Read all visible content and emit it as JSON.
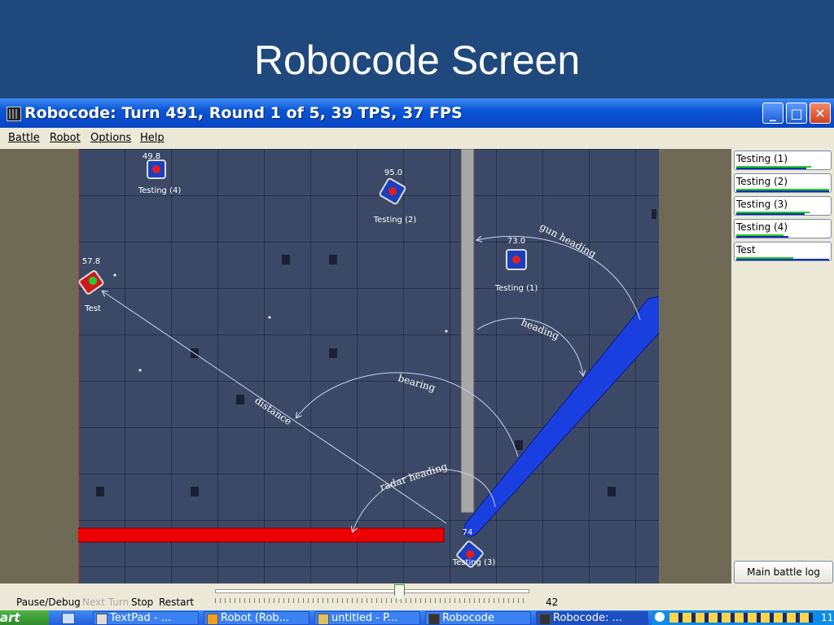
{
  "slide": {
    "title": "Robocode Screen"
  },
  "window": {
    "title": "Robocode: Turn 491, Round 1 of 5, 39 TPS, 37 FPS",
    "controls": {
      "minimize": "_",
      "maximize": "□",
      "close": "✕"
    }
  },
  "menu": [
    "Battle",
    "Robot",
    "Options",
    "Help"
  ],
  "arena": {
    "robots": [
      {
        "name": "Testing (4)",
        "energy": "49.8"
      },
      {
        "name": "Testing (2)",
        "energy": "95.0"
      },
      {
        "name": "Testing (1)",
        "energy": "73.0"
      },
      {
        "name": "Test",
        "energy": "57.8"
      },
      {
        "name": "Testing (3)",
        "energy": "74"
      }
    ],
    "annotations": {
      "gun_heading": "gun heading",
      "heading": "heading",
      "bearing": "bearing",
      "distance": "distance",
      "radar_heading": "radar heading"
    },
    "colors": {
      "radar_beam": "#1a3fe0",
      "test_bar": "#ee0000",
      "wall_bar": "#a8a8a8"
    }
  },
  "side_panel": {
    "robots": [
      {
        "label": "Testing (1)",
        "energy_color": "#22cc22"
      },
      {
        "label": "Testing (2)",
        "energy_color": "#22cc22"
      },
      {
        "label": "Testing (3)",
        "energy_color": "#22cc22"
      },
      {
        "label": "Testing (4)",
        "energy_color": "#22cc22"
      },
      {
        "label": "Test",
        "energy_color": "#22cc22"
      }
    ],
    "main_log": "Main battle log"
  },
  "controls": {
    "pause": "Pause/Debug",
    "next_turn": "Next Turn",
    "stop": "Stop",
    "restart": "Restart",
    "tps_value": "42"
  },
  "taskbar": {
    "start": "art",
    "items": [
      "TextPad - ...",
      "Robot (Rob...",
      "untitled - P...",
      "Robocode",
      "Robocode: ..."
    ],
    "clock": "11"
  }
}
